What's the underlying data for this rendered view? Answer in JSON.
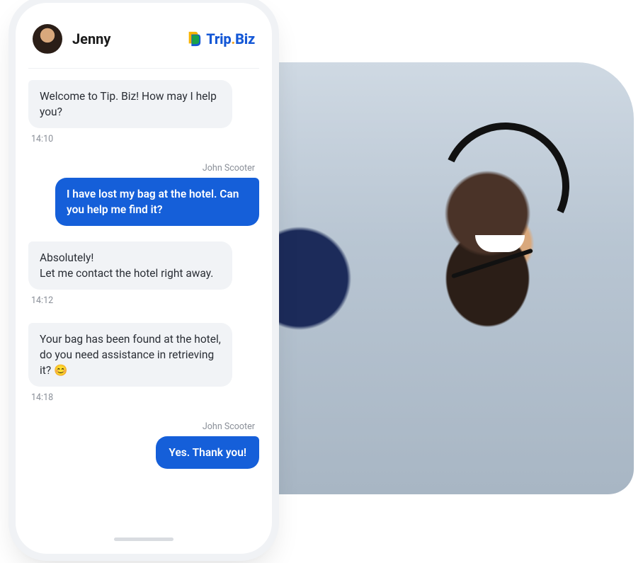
{
  "header": {
    "agent_name": "Jenny",
    "brand_word1": "Trip",
    "brand_dot": ".",
    "brand_word2": "Biz"
  },
  "customer_name": "John Scooter",
  "messages": [
    {
      "role": "agent",
      "text": "Welcome to Tip. Biz! How may I help you?",
      "time": "14:10"
    },
    {
      "role": "user",
      "sender": "John Scooter",
      "text": "I have lost my bag at the hotel. Can you help me find it?"
    },
    {
      "role": "agent",
      "text": "Absolutely!\nLet me contact the hotel right away.",
      "time": "14:12"
    },
    {
      "role": "agent",
      "text": "Your bag has been found at the hotel, do you need assistance in retrieving it? 😊",
      "time": "14:18"
    },
    {
      "role": "user",
      "sender": "John Scooter",
      "text": "Yes. Thank you!"
    }
  ]
}
